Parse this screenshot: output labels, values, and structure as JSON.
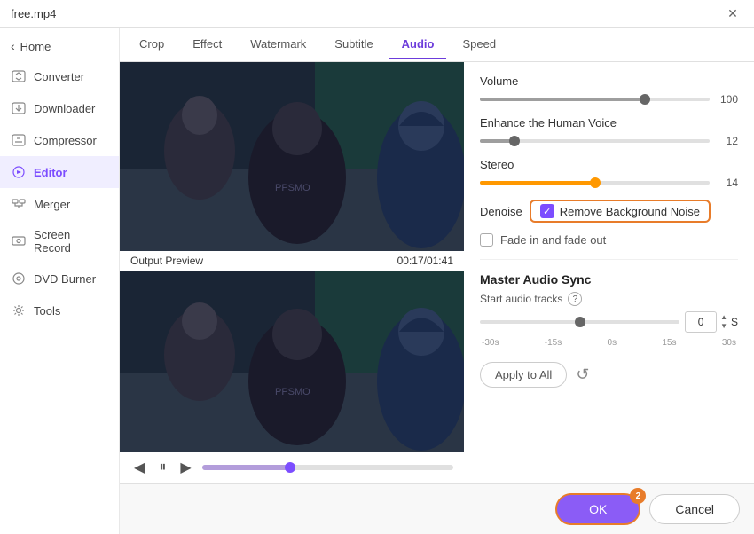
{
  "titlebar": {
    "filename": "free.mp4",
    "close_label": "✕"
  },
  "sidebar": {
    "back_label": "Home",
    "items": [
      {
        "id": "converter",
        "label": "Converter",
        "icon": "converter"
      },
      {
        "id": "downloader",
        "label": "Downloader",
        "icon": "downloader"
      },
      {
        "id": "compressor",
        "label": "Compressor",
        "icon": "compressor"
      },
      {
        "id": "editor",
        "label": "Editor",
        "icon": "editor",
        "active": true
      },
      {
        "id": "merger",
        "label": "Merger",
        "icon": "merger"
      },
      {
        "id": "screen-record",
        "label": "Screen Record",
        "icon": "screen-record"
      },
      {
        "id": "dvd-burner",
        "label": "DVD Burner",
        "icon": "dvd-burner"
      },
      {
        "id": "tools",
        "label": "Tools",
        "icon": "tools"
      }
    ]
  },
  "tabs": {
    "items": [
      {
        "id": "crop",
        "label": "Crop"
      },
      {
        "id": "effect",
        "label": "Effect"
      },
      {
        "id": "watermark",
        "label": "Watermark"
      },
      {
        "id": "subtitle",
        "label": "Subtitle"
      },
      {
        "id": "audio",
        "label": "Audio",
        "active": true
      },
      {
        "id": "speed",
        "label": "Speed"
      }
    ]
  },
  "video": {
    "preview_label": "Output Preview",
    "timestamp": "00:17/01:41"
  },
  "audio_panel": {
    "volume": {
      "label": "Volume",
      "value": 100,
      "fill_pct": 72
    },
    "enhance": {
      "label": "Enhance the Human Voice",
      "value": 12,
      "fill_pct": 15
    },
    "stereo": {
      "label": "Stereo",
      "value": 14,
      "fill_pct": 50
    },
    "denoise": {
      "label": "Denoise",
      "checkbox_label": "Remove Background Noise",
      "checked": true
    },
    "fade": {
      "label": "Fade in and fade out",
      "checked": false
    },
    "master_sync": {
      "title": "Master Audio Sync",
      "subtitle": "Start audio tracks",
      "ticks": [
        "-30s",
        "-15s",
        "0s",
        "15s",
        "30s"
      ],
      "value": 0,
      "s_label": "S"
    },
    "apply_all": "Apply to All",
    "reset_icon": "↺"
  },
  "footer": {
    "ok_label": "OK",
    "cancel_label": "Cancel",
    "ok_badge": "2"
  }
}
